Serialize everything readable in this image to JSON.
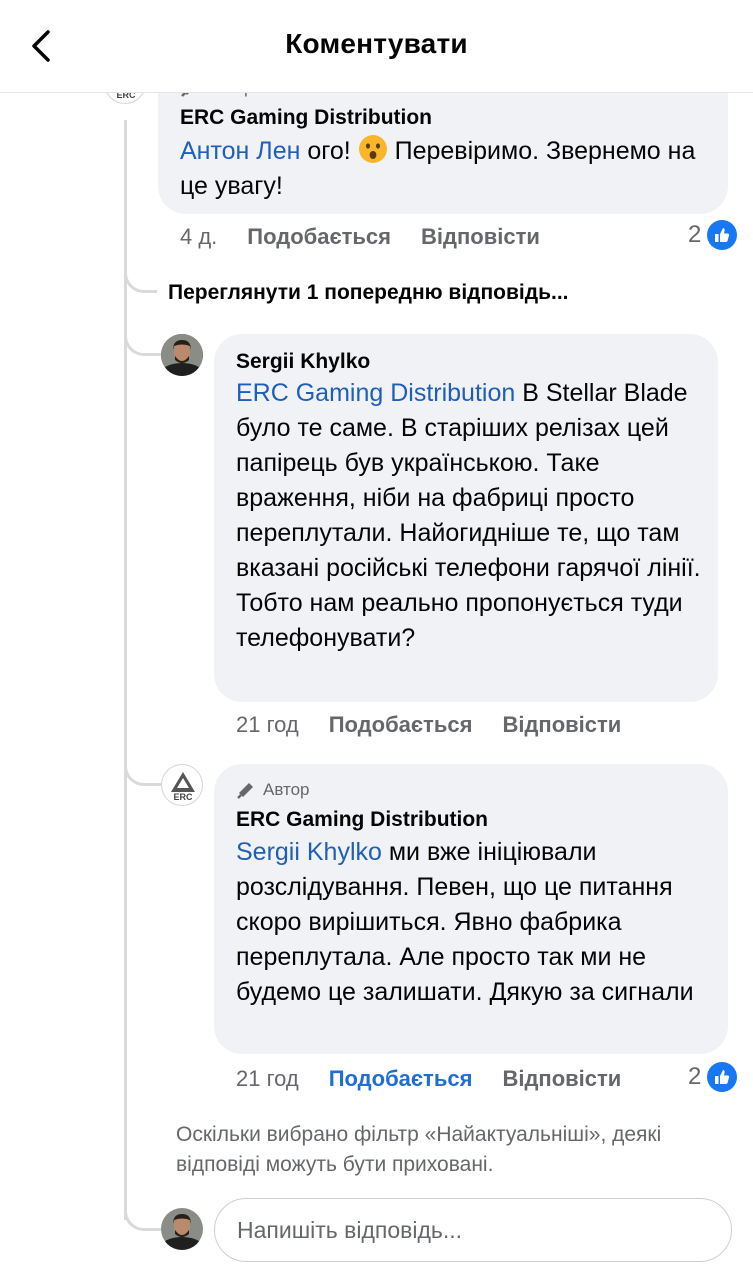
{
  "header": {
    "title": "Коментувати"
  },
  "comments": [
    {
      "author_tag": "Автор",
      "name": "ERC Gaming Distribution",
      "mention": "Антон Лен",
      "text_before_emoji": " ого!",
      "text_after_emoji": " Перевіримо. Звернемо на це увагу!",
      "time": "4 д.",
      "like": "Подобається",
      "reply": "Відповісти",
      "likes": "2"
    },
    {
      "name": "Sergii Khylko",
      "mention": "ERC Gaming Distribution",
      "text": " В Stellar Blade було те саме. В старіших релізах цей папірець був українською. Таке враження, ніби на фабриці просто переплутали. Найогидніше те, що там вказані російські телефони гарячої лінії. Тобто нам реально пропонується туди телефонувати?",
      "time": "21 год",
      "like": "Подобається",
      "reply": "Відповісти"
    },
    {
      "author_tag": "Автор",
      "name": "ERC Gaming Distribution",
      "mention": "Sergii Khylko",
      "text": " ми вже ініціювали розслідування. Певен, що це питання скоро вирішиться. Явно фабрика переплутала. Але просто так ми не будемо це залишати. Дякую за сигнали",
      "time": "21 год",
      "like": "Подобається",
      "reply": "Відповісти",
      "likes": "2"
    }
  ],
  "view_previous": "Переглянути 1 попередню відповідь...",
  "filter_note": "Оскільки вибрано фільтр «Найактуальніші», деякі відповіді можуть бути приховані.",
  "reply_input": {
    "placeholder": "Напишіть відповідь..."
  },
  "logo_text": "ERC",
  "colors": {
    "mention": "#1f5fb8",
    "like_active": "#1f6ed4",
    "like_badge": "#1877f2",
    "bubble": "#f0f2f5",
    "meta": "#65676b"
  }
}
